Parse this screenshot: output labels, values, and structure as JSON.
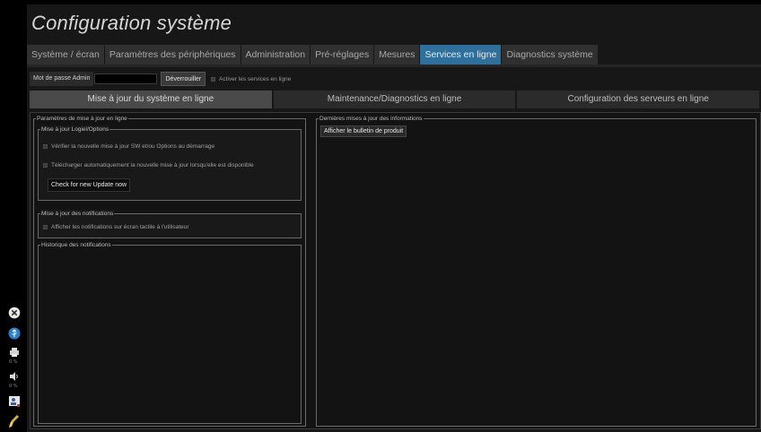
{
  "title": "Configuration système",
  "tabs": [
    {
      "label": "Système / écran",
      "active": false
    },
    {
      "label": "Paramètres des périphériques",
      "active": false
    },
    {
      "label": "Administration",
      "active": false
    },
    {
      "label": "Pré-réglages",
      "active": false
    },
    {
      "label": "Mesures",
      "active": false
    },
    {
      "label": "Services en ligne",
      "active": true
    },
    {
      "label": "Diagnostics système",
      "active": false
    }
  ],
  "admin": {
    "password_label": "Mot de passe Admin",
    "password_value": "",
    "unlock_button": "Déverrouiller",
    "enable_services_label": "Activer les services en ligne"
  },
  "subtabs": [
    {
      "label": "Mise à jour du système en ligne",
      "active": true
    },
    {
      "label": "Maintenance/Diagnostics en ligne",
      "active": false
    },
    {
      "label": "Configuration des serveurs en ligne",
      "active": false
    }
  ],
  "update_params": {
    "legend": "Paramètres de mise à jour en ligne",
    "software": {
      "legend": "Mise à jour Logiel/Options",
      "check_on_startup": "Vérifier la nouvelle mise à jour SW et/ou Options au démarrage",
      "auto_download": "Télécharger automatiquement la nouvelle mise à jour lorsqu'elle est disponible",
      "check_now_button": "Check for new Update now"
    },
    "notifications": {
      "legend": "Mise à jour des notifications",
      "show_touchscreen": "Afficher les notifications sur écran tactile à l'utilisateur"
    },
    "history": {
      "legend": "Historique des notifications"
    }
  },
  "latest_updates": {
    "legend": "Dernières mises à jour des informations",
    "bulletin_button": "Afficher le bulletin de produit"
  },
  "rail": {
    "icons": [
      "close-circle-icon",
      "usb-icon",
      "printer-icon",
      "speaker-icon",
      "user-card-icon",
      "brush-icon"
    ],
    "printer_pct": "0 %",
    "speaker_pct": "0 %"
  },
  "colors": {
    "active_tab": "#2e6f9c",
    "background": "#171717"
  }
}
